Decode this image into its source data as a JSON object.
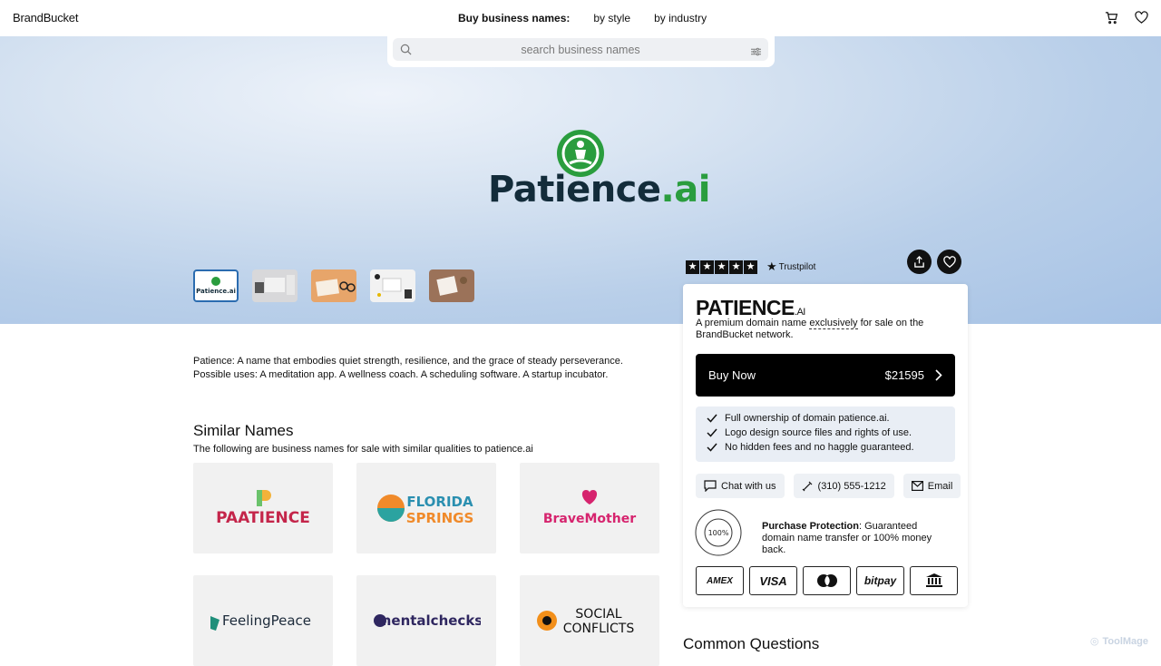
{
  "header": {
    "logo": "BrandBucket",
    "nav_lead": "Buy business names:",
    "nav_items": [
      "by style",
      "by industry"
    ],
    "icons": [
      "cart-icon",
      "heart-icon"
    ]
  },
  "search": {
    "placeholder": "search business names"
  },
  "hero": {
    "brand_main": "Patience",
    "brand_tld": ".ai",
    "thumbnails_count": 5
  },
  "trustpilot": {
    "label": "Trustpilot",
    "stars": 5
  },
  "card": {
    "name": "PATIENCE",
    "ext": ".AI",
    "desc_pre": "A premium domain name ",
    "desc_u": "exclusively",
    "desc_post": " for sale on the BrandBucket network.",
    "buy_label": "Buy Now",
    "price": "$21595",
    "features": [
      "Full ownership of domain patience.ai.",
      "Logo design source files and rights of use.",
      "No hidden fees and no haggle guaranteed."
    ],
    "contacts": [
      {
        "label": "Chat with us",
        "icon": "chat-icon"
      },
      {
        "label": "(310) 555-1212",
        "icon": "phone-icon"
      },
      {
        "label": "Email",
        "icon": "mail-icon"
      }
    ],
    "guarantee_seal": "100%",
    "protection_bold": "Purchase Protection",
    "protection_text": ": Guaranteed domain name transfer or 100% money back.",
    "payments": [
      "AMEX",
      "VISA",
      "mastercard",
      "bitpay",
      "bank"
    ]
  },
  "description": {
    "line1": "Patience: A name that embodies quiet strength, resilience, and the grace of steady perseverance.",
    "line2": "Possible uses: A meditation app. A wellness coach. A scheduling software. A startup incubator."
  },
  "similar": {
    "heading": "Similar Names",
    "sub": "The following are business names for sale with similar qualities to patience.ai",
    "items": [
      "PAATIENCE",
      "FLORIDA SPRINGS",
      "BraveMother",
      "FeelingPeace",
      "mentalchecks",
      "SOCIAL CONFLICTS"
    ]
  },
  "common_questions": "Common Questions",
  "watermark": "ToolMage",
  "colors": {
    "accent_green": "#2a9d3e",
    "navy": "#132c3a",
    "buy_bg": "#000000"
  }
}
